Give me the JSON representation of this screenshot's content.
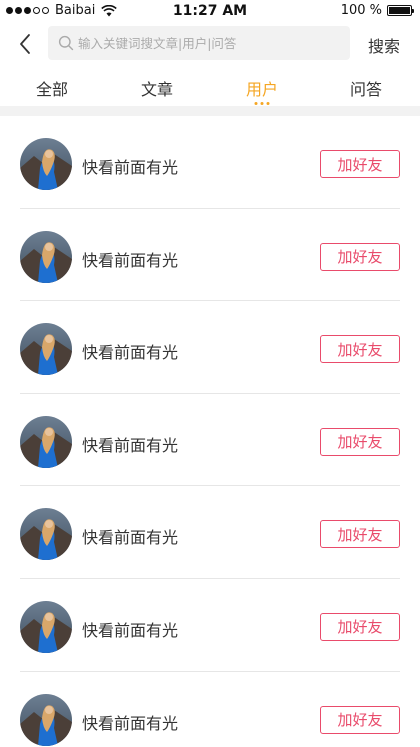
{
  "status_bar": {
    "carrier": "Baibai",
    "time": "11:27 AM",
    "battery": "100 %",
    "battery_level": 1.0,
    "signal_bars_filled": 3,
    "signal_bars_total": 5
  },
  "search": {
    "placeholder": "输入关键词搜文章|用户|问答",
    "value": "",
    "button_label": "搜索"
  },
  "tabs": [
    {
      "label": "全部",
      "active": false
    },
    {
      "label": "文章",
      "active": false
    },
    {
      "label": "用户",
      "active": true
    },
    {
      "label": "问答",
      "active": false
    }
  ],
  "users": [
    {
      "name": "快看前面有光",
      "action": "加好友"
    },
    {
      "name": "快看前面有光",
      "action": "加好友"
    },
    {
      "name": "快看前面有光",
      "action": "加好友"
    },
    {
      "name": "快看前面有光",
      "action": "加好友"
    },
    {
      "name": "快看前面有光",
      "action": "加好友"
    },
    {
      "name": "快看前面有光",
      "action": "加好友"
    },
    {
      "name": "快看前面有光",
      "action": "加好友"
    }
  ],
  "colors": {
    "accent": "#f5a623",
    "action": "#e94b6b",
    "divider": "#f2f2f2"
  }
}
